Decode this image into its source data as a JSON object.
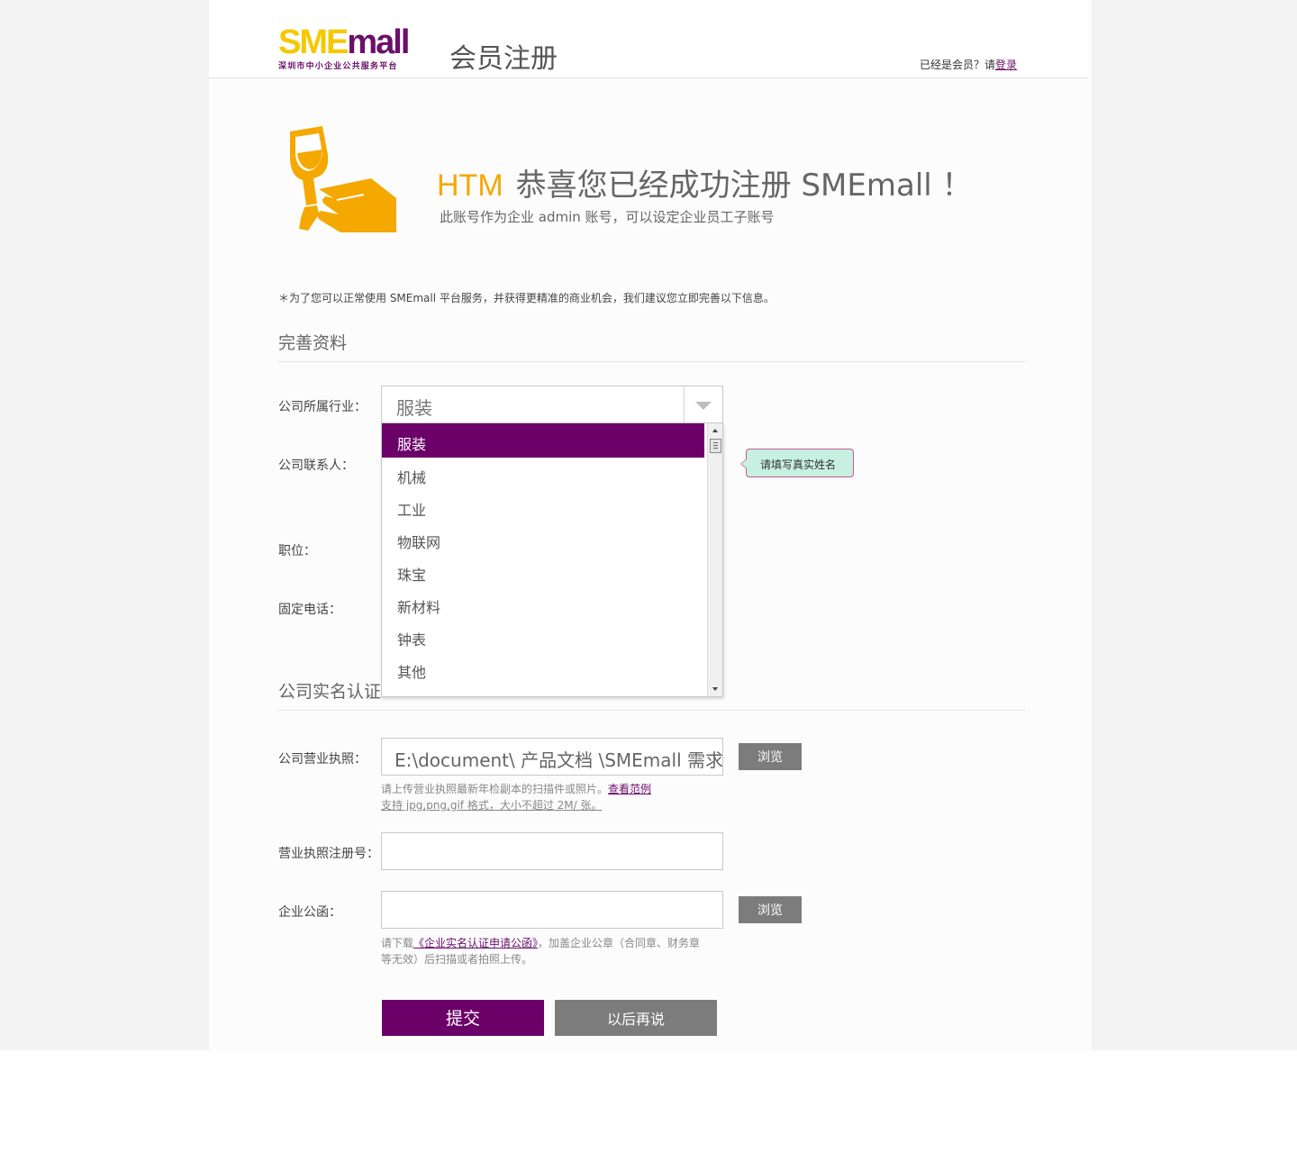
{
  "header": {
    "logo_main_sme": "SME",
    "logo_main_mall": "mall",
    "logo_sub": "深圳市中小企业公共服务平台",
    "title": "会员注册",
    "login_prompt": "已经是会员？请",
    "login_link": "登录"
  },
  "success": {
    "username": "HTM",
    "message": "恭喜您已经成功注册 SMEmall ！",
    "subtext": "此账号作为企业 admin 账号，可以设定企业员工子账号"
  },
  "notice": "＊为了您可以正常使用 SMEmall 平台服务，并获得更精准的商业机会，我们建议您立即完善以下信息。",
  "profile_section": {
    "title": "完善资料",
    "industry_label": "公司所属行业：",
    "industry_value": "服装",
    "industry_options": [
      "服装",
      "机械",
      "工业",
      "物联网",
      "珠宝",
      "新材料",
      "钟表",
      "其他"
    ],
    "contact_label": "公司联系人：",
    "contact_tooltip": "请填写真实姓名",
    "position_label": "职位：",
    "phone_label": "固定电话："
  },
  "verify_section": {
    "title": "公司实名认证",
    "license_label": "公司营业执照：",
    "license_value": "E:\\document\\ 产品文档 \\SMEmall 需求 \\",
    "browse_label": "浏览",
    "license_hint_1": "请上传营业执照最新年检副本的扫描件或照片。",
    "license_hint_link": "查看范例",
    "license_hint_2": "支持 jpg,png,gif 格式，大小不超过 2M/ 张。",
    "reg_no_label": "营业执照注册号：",
    "reg_no_value": "",
    "letter_label": "企业公函：",
    "letter_value": "",
    "letter_hint_1": "请下载",
    "letter_hint_link": "《企业实名认证申请公函》",
    "letter_hint_2": "，加盖企业公章（合同章、财务章",
    "letter_hint_3": "等无效）后扫描或者拍照上传。"
  },
  "actions": {
    "submit": "提交",
    "later": "以后再说"
  },
  "colors": {
    "brand_purple": "#6b0069",
    "brand_yellow": "#f5c800",
    "accent_orange": "#f5a800",
    "button_gray": "#7c7c7c"
  }
}
